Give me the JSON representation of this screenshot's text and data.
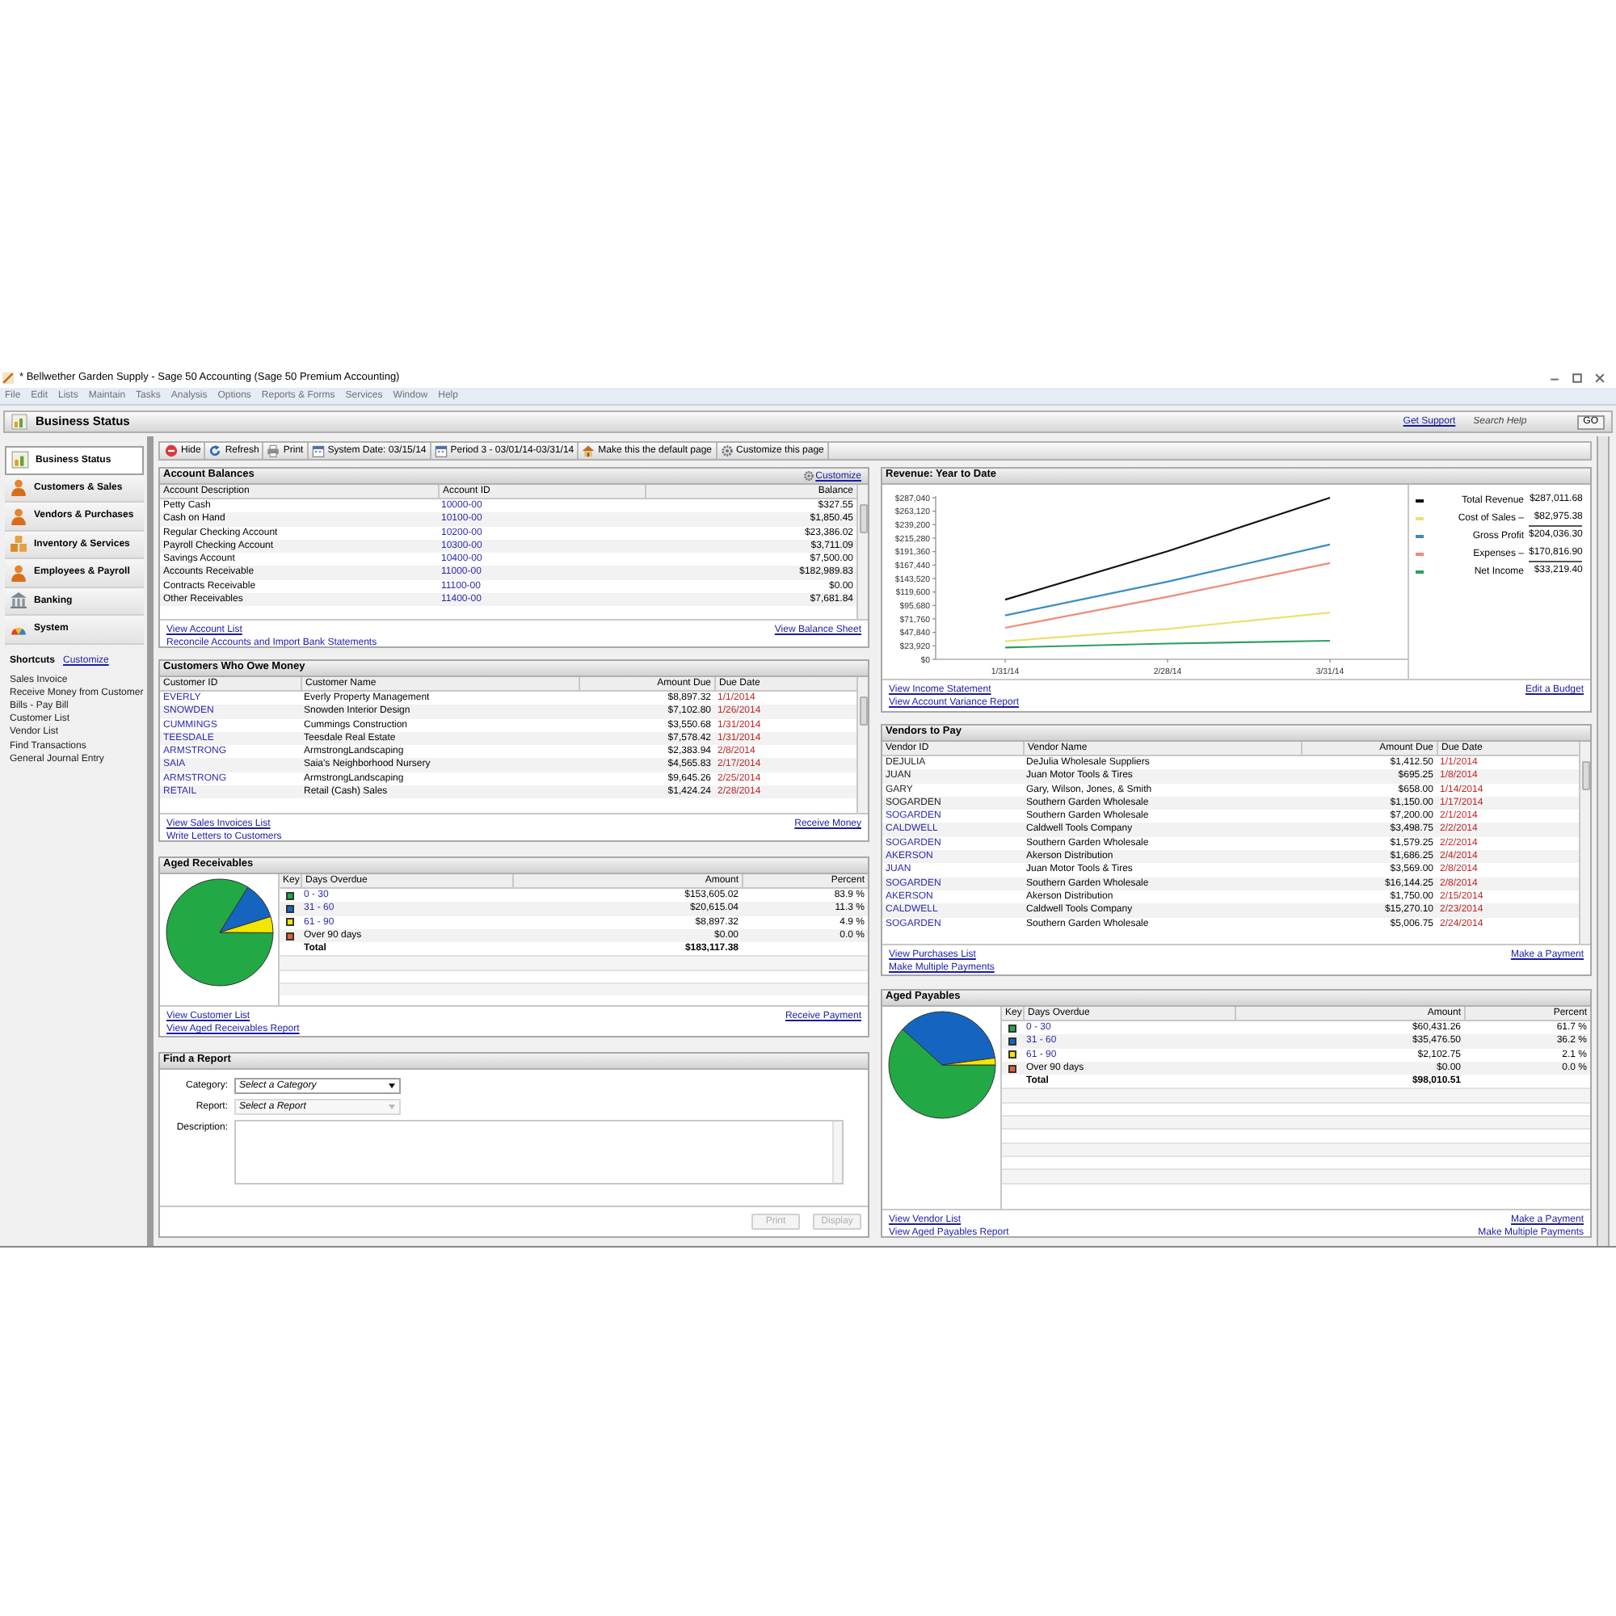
{
  "window": {
    "title": "* Bellwether Garden Supply - Sage 50 Accounting (Sage 50 Premium Accounting)"
  },
  "menu": [
    "File",
    "Edit",
    "Lists",
    "Maintain",
    "Tasks",
    "Analysis",
    "Options",
    "Reports & Forms",
    "Services",
    "Window",
    "Help"
  ],
  "header": {
    "title": "Business Status",
    "support_link": "Get Support",
    "search": {
      "placeholder": "Search Help"
    },
    "go_button": "GO"
  },
  "sidebar": {
    "items": [
      {
        "label": "Business Status",
        "kind": "status",
        "selected": true
      },
      {
        "label": "Customers & Sales",
        "kind": "person",
        "selected": false
      },
      {
        "label": "Vendors & Purchases",
        "kind": "person",
        "selected": false
      },
      {
        "label": "Inventory & Services",
        "kind": "boxes",
        "selected": false
      },
      {
        "label": "Employees & Payroll",
        "kind": "person",
        "selected": false
      },
      {
        "label": "Banking",
        "kind": "bank",
        "selected": false
      },
      {
        "label": "System",
        "kind": "system",
        "selected": false
      }
    ],
    "shortcuts_title": "Shortcuts",
    "shortcuts_customize": "Customize",
    "shortcuts": [
      "Sales Invoice",
      "Receive Money from Customer",
      "Bills - Pay Bill",
      "Customer List",
      "Vendor List",
      "Find Transactions",
      "General Journal Entry"
    ]
  },
  "toolbar": [
    {
      "label": "Hide",
      "kind": "hide"
    },
    {
      "label": "Refresh",
      "kind": "refresh"
    },
    {
      "label": "Print",
      "kind": "print"
    },
    {
      "label": "System Date: 03/15/14",
      "kind": "date"
    },
    {
      "label": "Period 3 - 03/01/14-03/31/14",
      "kind": "date"
    },
    {
      "label": "Make this the default page",
      "kind": "home"
    },
    {
      "label": "Customize this page",
      "kind": "customize"
    }
  ],
  "account_balances": {
    "title": "Account Balances",
    "customize": "Customize",
    "columns": [
      "Account Description",
      "Account ID",
      "Balance"
    ],
    "rows": [
      [
        "Petty Cash",
        "10000-00",
        "$327.55"
      ],
      [
        "Cash on Hand",
        "10100-00",
        "$1,850.45"
      ],
      [
        "Regular Checking Account",
        "10200-00",
        "$23,386.02"
      ],
      [
        "Payroll Checking Account",
        "10300-00",
        "$3,711.09"
      ],
      [
        "Savings Account",
        "10400-00",
        "$7,500.00"
      ],
      [
        "Accounts Receivable",
        "11000-00",
        "$182,989.83"
      ],
      [
        "Contracts Receivable",
        "11100-00",
        "$0.00"
      ],
      [
        "Other Receivables",
        "11400-00",
        "$7,681.84"
      ]
    ],
    "links_left": [
      "View Account List",
      "Reconcile Accounts and Import Bank Statements"
    ],
    "links_right": [
      "View Balance Sheet"
    ]
  },
  "customers": {
    "title": "Customers Who Owe Money",
    "columns": [
      "Customer ID",
      "Customer Name",
      "Amount Due",
      "Due Date"
    ],
    "rows": [
      [
        "EVERLY",
        "Everly Property Management",
        "$8,897.32",
        "1/1/2014"
      ],
      [
        "SNOWDEN",
        "Snowden Interior Design",
        "$7,102.80",
        "1/26/2014"
      ],
      [
        "CUMMINGS",
        "Cummings Construction",
        "$3,550.68",
        "1/31/2014"
      ],
      [
        "TEESDALE",
        "Teesdale Real Estate",
        "$7,578.42",
        "1/31/2014"
      ],
      [
        "ARMSTRONG",
        "ArmstrongLandscaping",
        "$2,383.94",
        "2/8/2014"
      ],
      [
        "SAIA",
        "Saia's Neighborhood Nursery",
        "$4,565.83",
        "2/17/2014"
      ],
      [
        "ARMSTRONG",
        "ArmstrongLandscaping",
        "$9,645.26",
        "2/25/2014"
      ],
      [
        "RETAIL",
        "Retail (Cash) Sales",
        "$1,424.24",
        "2/28/2014"
      ]
    ],
    "links_left": [
      "View Sales Invoices List",
      "Write Letters to Customers"
    ],
    "links_right": [
      "Receive Money"
    ]
  },
  "aged_receivables": {
    "title": "Aged Receivables",
    "columns": [
      "Key",
      "Days Overdue",
      "Amount",
      "Percent"
    ],
    "rows": [
      {
        "range": "0 - 30",
        "link": true,
        "amount": "$153,605.02",
        "percent": "83.9 %",
        "color": "#22a845"
      },
      {
        "range": "31 - 60",
        "link": true,
        "amount": "$20,615.04",
        "percent": "11.3 %",
        "color": "#1565c0"
      },
      {
        "range": "61 - 90",
        "link": true,
        "amount": "$8,897.32",
        "percent": "4.9 %",
        "color": "#f2e600"
      },
      {
        "range": "Over 90 days",
        "link": false,
        "amount": "$0.00",
        "percent": "0.0 %",
        "color": "#e06030"
      }
    ],
    "total": {
      "label": "Total",
      "amount": "$183,117.38"
    },
    "links_left": [
      "View Customer List",
      "View Aged Receivables Report"
    ],
    "links_right": [
      "Receive Payment"
    ]
  },
  "find_report": {
    "title": "Find a Report",
    "fields": [
      {
        "label": "Category:",
        "placeholder": "Select a Category",
        "disabled": false
      },
      {
        "label": "Report:",
        "placeholder": "Select a Report",
        "disabled": true
      }
    ],
    "description_label": "Description:",
    "buttons": [
      {
        "label": "Print",
        "disabled": true
      },
      {
        "label": "Display",
        "disabled": true
      }
    ]
  },
  "revenue": {
    "title": "Revenue: Year to Date",
    "chart_data": {
      "type": "line",
      "categories": [
        "1/31/14",
        "2/28/14",
        "3/31/14"
      ],
      "yticks": [
        {
          "value": 0,
          "label": "$0"
        },
        {
          "value": 23920,
          "label": "$23,920"
        },
        {
          "value": 47840,
          "label": "$47,840"
        },
        {
          "value": 71760,
          "label": "$71,760"
        },
        {
          "value": 95680,
          "label": "$95,680"
        },
        {
          "value": 119600,
          "label": "$119,600"
        },
        {
          "value": 143520,
          "label": "$143,520"
        },
        {
          "value": 167440,
          "label": "$167,440"
        },
        {
          "value": 191360,
          "label": "$191,360"
        },
        {
          "value": 215280,
          "label": "$215,280"
        },
        {
          "value": 239200,
          "label": "$239,200"
        },
        {
          "value": 263120,
          "label": "$263,120"
        },
        {
          "value": 287040,
          "label": "$287,040"
        }
      ],
      "ylim": [
        0,
        287040
      ],
      "series": [
        {
          "name": "Total Revenue",
          "color": "#111111",
          "values": [
            106000,
            192000,
            287000
          ]
        },
        {
          "name": "Cost of Sales",
          "color": "#ece070",
          "values": [
            32000,
            54000,
            83000
          ]
        },
        {
          "name": "Gross Profit",
          "color": "#3a8cc4",
          "values": [
            78000,
            138000,
            204000
          ]
        },
        {
          "name": "Expenses",
          "color": "#ef8a78",
          "values": [
            56000,
            111000,
            171000
          ]
        },
        {
          "name": "Net Income",
          "color": "#2e9e5e",
          "values": [
            21000,
            28000,
            33000
          ]
        }
      ]
    },
    "legend": [
      {
        "amount": "$287,011.68",
        "subtotal_rule": false
      },
      {
        "suffix": "–",
        "amount": "$82,975.38",
        "subtotal_rule": true
      },
      {
        "amount": "$204,036.30",
        "subtotal_rule": false
      },
      {
        "suffix": "–",
        "amount": "$170,816.90",
        "subtotal_rule": true
      },
      {
        "amount": "$33,219.40",
        "subtotal_rule": false
      }
    ],
    "links_left": [
      "View Income Statement",
      "View Account Variance Report"
    ],
    "links_right": [
      "Edit a Budget"
    ]
  },
  "vendors": {
    "title": "Vendors to Pay",
    "columns": [
      "Vendor ID",
      "Vendor Name",
      "Amount Due",
      "Due Date"
    ],
    "rows": [
      {
        "cells": [
          "DEJULIA",
          "DeJulia Wholesale Suppliers",
          "$1,412.50",
          "1/1/2014"
        ],
        "link": false
      },
      {
        "cells": [
          "JUAN",
          "Juan Motor Tools & Tires",
          "$695.25",
          "1/8/2014"
        ],
        "link": false
      },
      {
        "cells": [
          "GARY",
          "Gary, Wilson, Jones, & Smith",
          "$658.00",
          "1/14/2014"
        ],
        "link": false
      },
      {
        "cells": [
          "SOGARDEN",
          "Southern Garden Wholesale",
          "$1,150.00",
          "1/17/2014"
        ],
        "link": false
      },
      {
        "cells": [
          "SOGARDEN",
          "Southern Garden Wholesale",
          "$7,200.00",
          "2/1/2014"
        ],
        "link": true
      },
      {
        "cells": [
          "CALDWELL",
          "Caldwell Tools Company",
          "$3,498.75",
          "2/2/2014"
        ],
        "link": true
      },
      {
        "cells": [
          "SOGARDEN",
          "Southern Garden Wholesale",
          "$1,579.25",
          "2/2/2014"
        ],
        "link": true
      },
      {
        "cells": [
          "AKERSON",
          "Akerson Distribution",
          "$1,686.25",
          "2/4/2014"
        ],
        "link": true
      },
      {
        "cells": [
          "JUAN",
          "Juan Motor Tools & Tires",
          "$3,569.00",
          "2/8/2014"
        ],
        "link": true
      },
      {
        "cells": [
          "SOGARDEN",
          "Southern Garden Wholesale",
          "$16,144.25",
          "2/8/2014"
        ],
        "link": true
      },
      {
        "cells": [
          "AKERSON",
          "Akerson Distribution",
          "$1,750.00",
          "2/15/2014"
        ],
        "link": true
      },
      {
        "cells": [
          "CALDWELL",
          "Caldwell Tools Company",
          "$15,270.10",
          "2/23/2014"
        ],
        "link": true
      },
      {
        "cells": [
          "SOGARDEN",
          "Southern Garden Wholesale",
          "$5,006.75",
          "2/24/2014"
        ],
        "link": true
      }
    ],
    "links_left": [
      "View Purchases List",
      "Make Multiple Payments"
    ],
    "links_right": [
      "Make a Payment"
    ]
  },
  "aged_payables": {
    "title": "Aged Payables",
    "columns": [
      "Key",
      "Days Overdue",
      "Amount",
      "Percent"
    ],
    "rows": [
      {
        "range": "0 - 30",
        "link": true,
        "amount": "$60,431.26",
        "percent": "61.7 %",
        "color": "#22a845"
      },
      {
        "range": "31 - 60",
        "link": true,
        "amount": "$35,476.50",
        "percent": "36.2 %",
        "color": "#1565c0"
      },
      {
        "range": "61 - 90",
        "link": true,
        "amount": "$2,102.75",
        "percent": "2.1 %",
        "color": "#f2e600"
      },
      {
        "range": "Over 90 days",
        "link": false,
        "amount": "$0.00",
        "percent": "0.0 %",
        "color": "#e06030"
      }
    ],
    "total": {
      "label": "Total",
      "amount": "$98,010.51"
    },
    "links_left": [
      "View Vendor List",
      "View Aged Payables Report"
    ],
    "links_right": [
      "Make a Payment",
      "Make Multiple Payments"
    ]
  }
}
